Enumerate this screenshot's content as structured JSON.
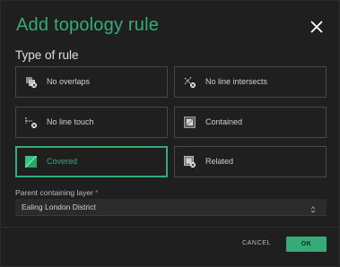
{
  "dialog": {
    "title": "Add topology rule",
    "close_icon": "close-icon"
  },
  "rule_section": {
    "label": "Type of rule",
    "rules": [
      {
        "label": "No overlaps",
        "icon": "no-overlaps-icon",
        "selected": false
      },
      {
        "label": "No line intersects",
        "icon": "no-line-intersects-icon",
        "selected": false
      },
      {
        "label": "No line touch",
        "icon": "no-line-touch-icon",
        "selected": false
      },
      {
        "label": "Contained",
        "icon": "contained-icon",
        "selected": false
      },
      {
        "label": "Covered",
        "icon": "covered-icon",
        "selected": true
      },
      {
        "label": "Related",
        "icon": "related-icon",
        "selected": false
      }
    ]
  },
  "layer": {
    "label": "Parent containing layer",
    "required_marker": "*",
    "value": "Ealing London District",
    "chevron_icon": "chevron-updown-icon"
  },
  "footer": {
    "cancel_label": "CANCEL",
    "ok_label": "OK"
  },
  "colors": {
    "accent": "#35ac77",
    "background": "#1f1f1f",
    "border": "#474747",
    "required": "#e45f5f"
  }
}
